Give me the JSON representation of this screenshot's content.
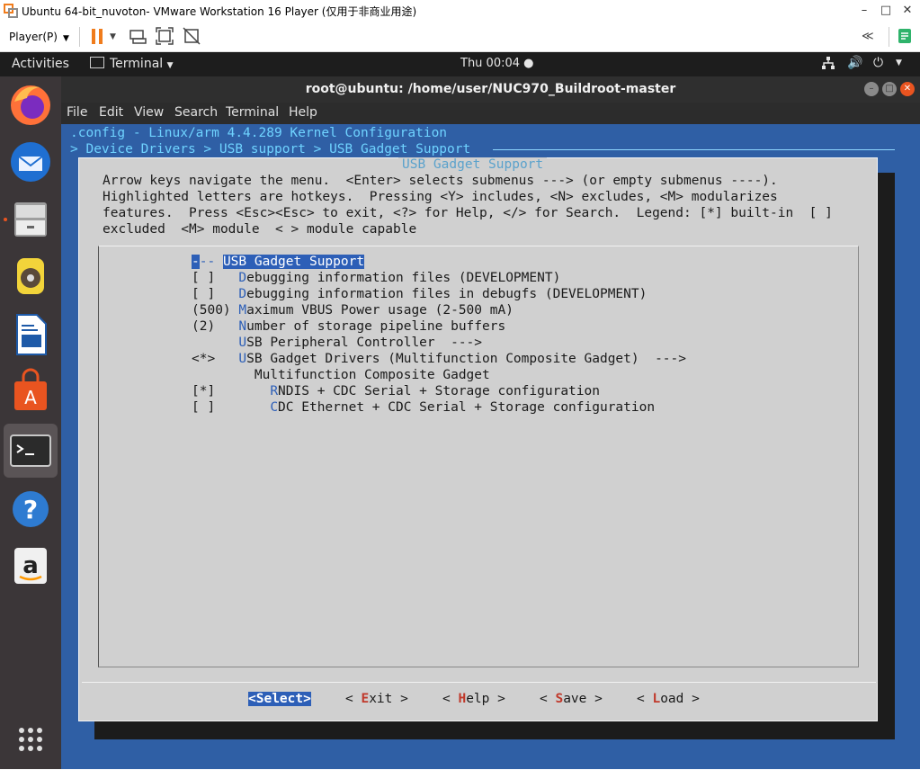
{
  "vmware": {
    "title": "Ubuntu 64-bit_nuvoton- VMware Workstation 16 Player (仅用于非商业用途)",
    "player_menu": "Player(P)",
    "colors": {
      "accent": "#f07c1c",
      "green": "#2fb36b"
    }
  },
  "ubuntu": {
    "activities": "Activities",
    "app_menu": "Terminal",
    "clock": "Thu 00:04",
    "dock_items": [
      "firefox-icon",
      "thunderbird-icon",
      "files-icon",
      "rhythmbox-icon",
      "libreoffice-writer-icon",
      "software-center-icon",
      "terminal-icon",
      "help-icon",
      "amazon-icon",
      "show-apps-icon"
    ]
  },
  "terminal": {
    "title": "root@ubuntu: /home/user/NUC970_Buildroot-master",
    "menu": [
      "File",
      "Edit",
      "View",
      "Search",
      "Terminal",
      "Help"
    ]
  },
  "kconfig": {
    "config_line": ".config - Linux/arm 4.4.289 Kernel Configuration",
    "breadcrumb": "> Device Drivers > USB support > USB Gadget Support ",
    "dialog_title": "USB Gadget Support",
    "help_lines": [
      "Arrow keys navigate the menu.  <Enter> selects submenus ---> (or empty submenus ----).",
      "Highlighted letters are hotkeys.  Pressing <Y> includes, <N> excludes, <M> modularizes",
      "features.  Press <Esc><Esc> to exit, <?> for Help, </> for Search.  Legend: [*] built-in  [ ]",
      "excluded  <M> module  < > module capable"
    ],
    "items": [
      {
        "prefix": "--- ",
        "hotkey": "",
        "text": "USB Gadget Support",
        "selected": true
      },
      {
        "prefix": "[ ]   ",
        "hotkey": "D",
        "text": "ebugging information files (DEVELOPMENT)"
      },
      {
        "prefix": "[ ]   ",
        "hotkey": "D",
        "text": "ebugging information files in debugfs (DEVELOPMENT)"
      },
      {
        "prefix": "(500) ",
        "hotkey": "M",
        "text": "aximum VBUS Power usage (2-500 mA)"
      },
      {
        "prefix": "(2)   ",
        "hotkey": "N",
        "text": "umber of storage pipeline buffers"
      },
      {
        "prefix": "      ",
        "hotkey": "U",
        "text": "SB Peripheral Controller  --->"
      },
      {
        "prefix": "<*>   ",
        "hotkey": "U",
        "text": "SB Gadget Drivers (Multifunction Composite Gadget)  --->"
      },
      {
        "prefix": "        ",
        "hotkey": "",
        "text": "Multifunction Composite Gadget"
      },
      {
        "prefix": "[*]       ",
        "hotkey": "R",
        "text": "NDIS + CDC Serial + Storage configuration"
      },
      {
        "prefix": "[ ]       ",
        "hotkey": "C",
        "text": "DC Ethernet + CDC Serial + Storage configuration"
      }
    ],
    "buttons": [
      {
        "pre": "<",
        "hotkey": "S",
        "post": "elect>"
      },
      {
        "pre": "< ",
        "hotkey": "E",
        "post": "xit >"
      },
      {
        "pre": "< ",
        "hotkey": "H",
        "post": "elp >"
      },
      {
        "pre": "< ",
        "hotkey": "S",
        "post": "ave >"
      },
      {
        "pre": "< ",
        "hotkey": "L",
        "post": "oad >"
      }
    ]
  }
}
